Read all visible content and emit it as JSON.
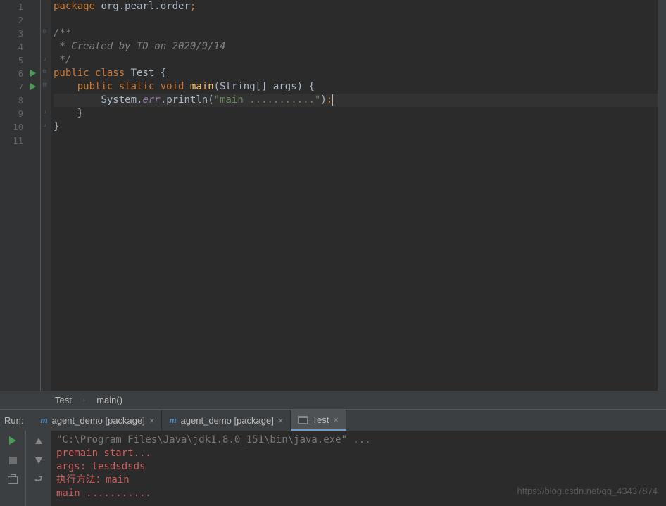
{
  "code": {
    "lines": [
      1,
      2,
      3,
      4,
      5,
      6,
      7,
      8,
      9,
      10,
      11
    ],
    "l1_kw": "package",
    "l1_pkg": " org.pearl.order",
    "l1_semi": ";",
    "l3": "/**",
    "l4": " * Created by TD on 2020/9/14",
    "l5": " */",
    "l6_kw1": "public",
    "l6_kw2": "class",
    "l6_cls": "Test",
    "l6_brace": "{",
    "l7_kw1": "public",
    "l7_kw2": "static",
    "l7_kw3": "void",
    "l7_m": "main",
    "l7_sig": "(String[] args) {",
    "l8_sys": "System.",
    "l8_err": "err",
    "l8_dot": ".",
    "l8_m": "println",
    "l8_p1": "(",
    "l8_str": "\"main ...........\"",
    "l8_p2": ")",
    "l8_semi": ";",
    "l9": "    }",
    "l10": "}"
  },
  "breadcrumb": {
    "c1": "Test",
    "c2": "main()"
  },
  "run": {
    "label": "Run:",
    "tabs": {
      "t1": "agent_demo [package]",
      "t2": "agent_demo [package]",
      "t3": "Test"
    },
    "console": {
      "c1": "\"C:\\Program Files\\Java\\jdk1.8.0_151\\bin\\java.exe\" ...",
      "c2": "premain start...",
      "c3": "args: tesdsdsds",
      "c4": "执行方法：main",
      "c5": "main ..........."
    }
  },
  "watermark": "https://blog.csdn.net/qq_43437874"
}
